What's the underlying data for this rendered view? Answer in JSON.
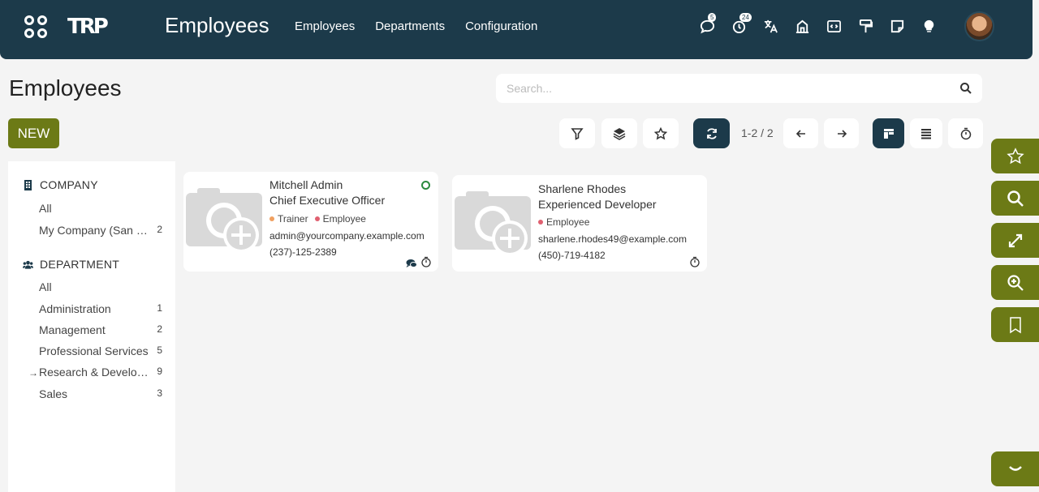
{
  "navbar": {
    "logo_text": "TRP",
    "app_title": "Employees",
    "menu": [
      "Employees",
      "Departments",
      "Configuration"
    ],
    "systray": [
      {
        "icon": "chat-icon",
        "badge": "5"
      },
      {
        "icon": "activity-clock-icon",
        "badge": "24"
      },
      {
        "icon": "translate-icon",
        "badge": ""
      },
      {
        "icon": "company-icon",
        "badge": ""
      },
      {
        "icon": "code-icon",
        "badge": ""
      },
      {
        "icon": "paint-roller-icon",
        "badge": ""
      },
      {
        "icon": "note-icon",
        "badge": ""
      },
      {
        "icon": "lightbulb-icon",
        "badge": ""
      }
    ]
  },
  "control": {
    "page_title": "Employees",
    "search_placeholder": "Search...",
    "new_label": "NEW",
    "pager": "1-2 / 2"
  },
  "sidebar": {
    "company_header": "COMPANY",
    "company_items": [
      {
        "label": "All",
        "count": ""
      },
      {
        "label": "My Company (San Francisco)",
        "count": "2"
      }
    ],
    "department_header": "DEPARTMENT",
    "department_items": [
      {
        "label": "All",
        "count": ""
      },
      {
        "label": "Administration",
        "count": "1"
      },
      {
        "label": "Management",
        "count": "2"
      },
      {
        "label": "Professional Services",
        "count": "5"
      },
      {
        "label": "Research & Development",
        "count": "9"
      },
      {
        "label": "Sales",
        "count": "3"
      }
    ]
  },
  "employees": [
    {
      "name": "Mitchell Admin",
      "job": "Chief Executive Officer",
      "tags": [
        "Trainer",
        "Employee"
      ],
      "email": "admin@yourcompany.example.com",
      "phone": "(237)-125-2389"
    },
    {
      "name": "Sharlene Rhodes",
      "job": "Experienced Developer",
      "tags": [
        "Employee"
      ],
      "email": "sharlene.rhodes49@example.com",
      "phone": "(450)-719-4182"
    }
  ],
  "colors": {
    "navbar": "#1c3a4a",
    "accent": "#6c7a16",
    "tag_trainer": "#f0a060",
    "tag_employee": "#e06070",
    "presence": "#2b8a3e"
  }
}
